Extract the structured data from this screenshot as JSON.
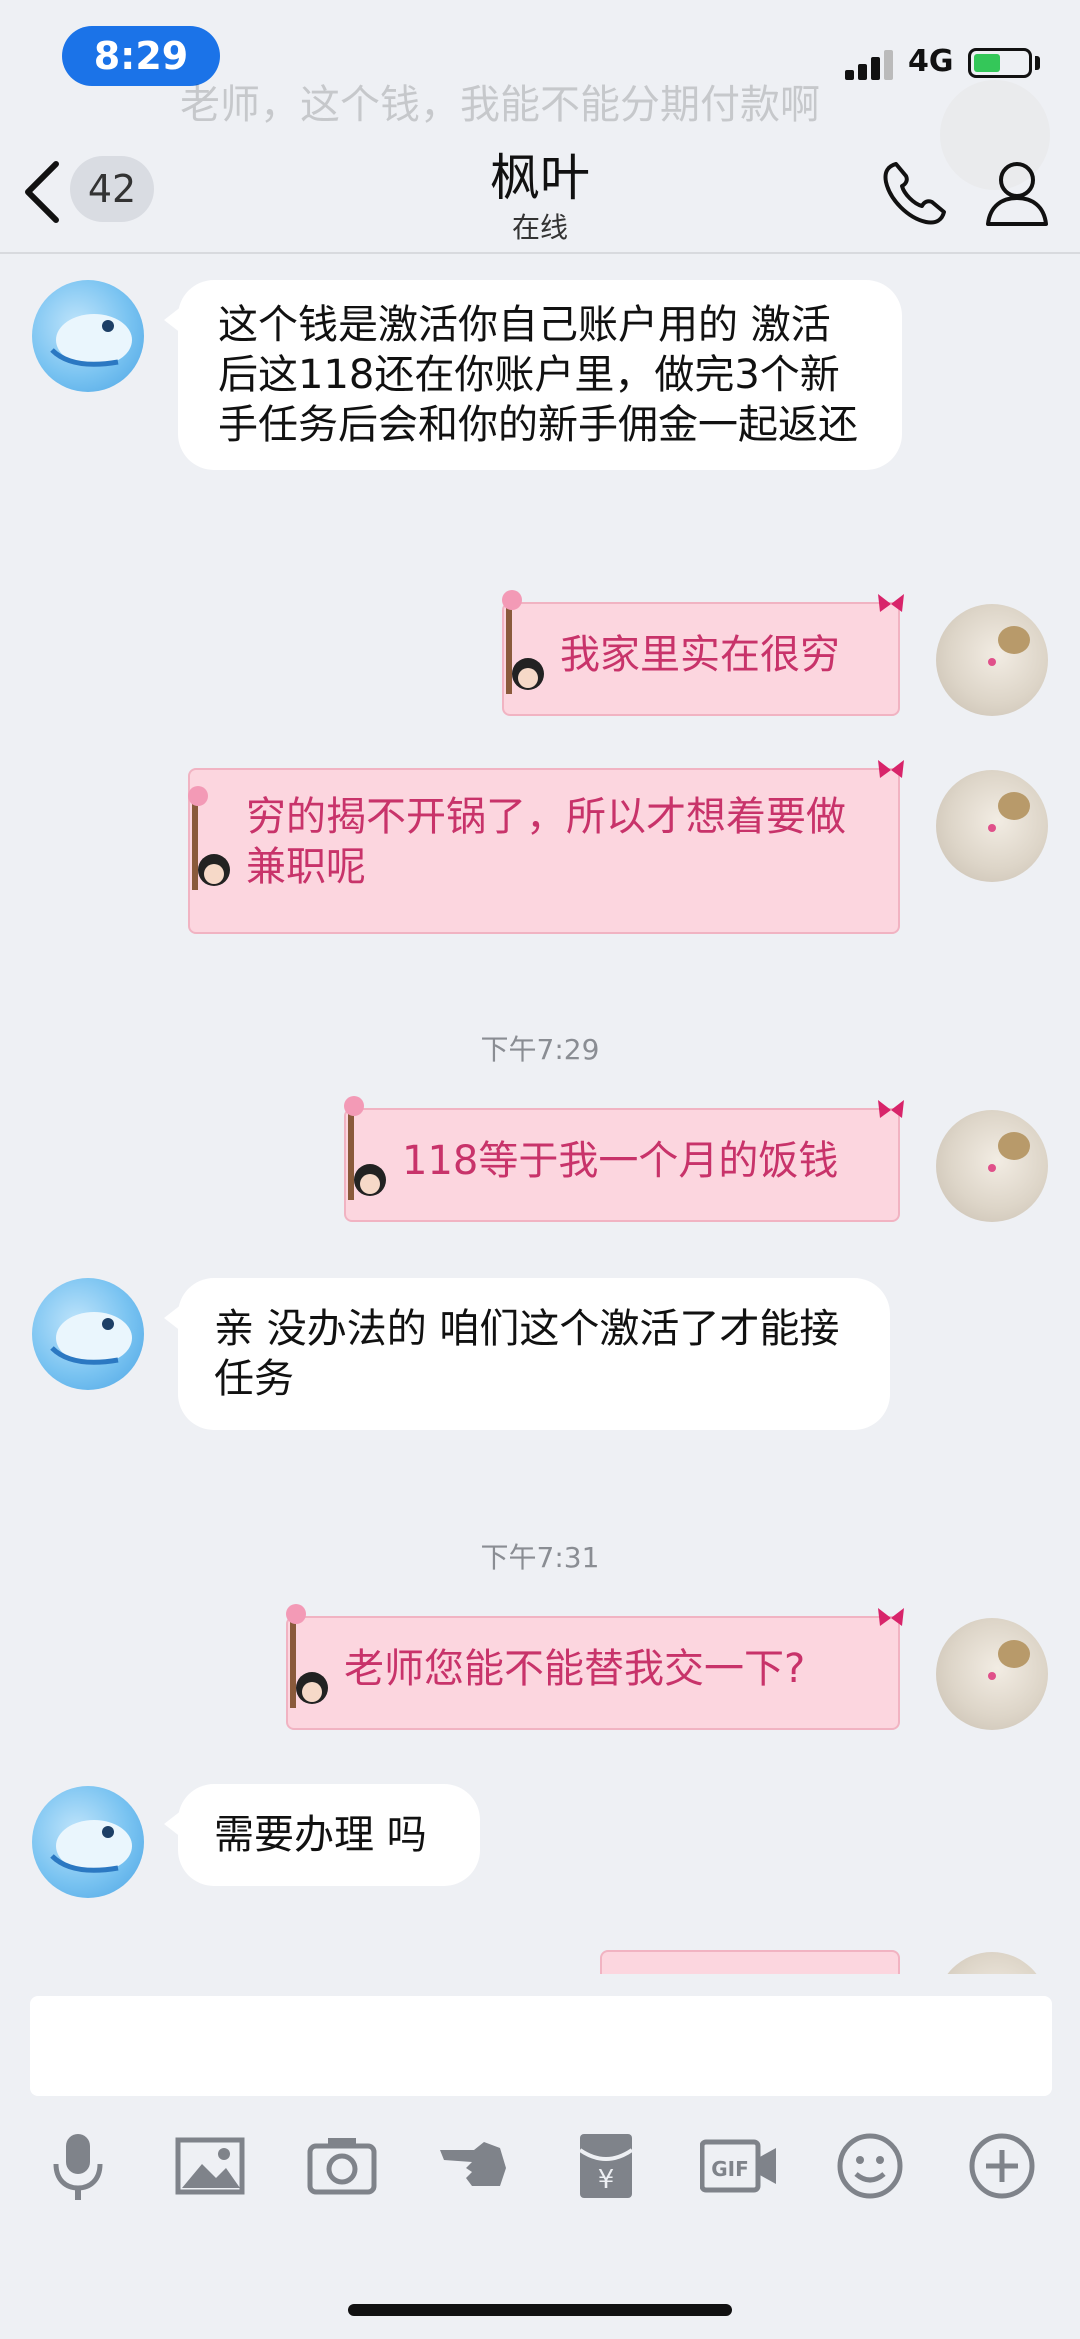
{
  "status_bar": {
    "time": "8:29",
    "network": "4G"
  },
  "header": {
    "back_count": "42",
    "title": "枫叶",
    "subtitle": "在线",
    "ghost_banner_text": "老师，这个钱，我能不能分期付款啊"
  },
  "messages": [
    {
      "side": "in",
      "text": "这个钱是激活你自己账户用的  激活后这118还在你账户里，做完3个新手任务后会和你的新手佣金一起返还"
    },
    {
      "side": "out",
      "text": "我家里实在很穷"
    },
    {
      "side": "out",
      "text": "穷的揭不开锅了，所以才想着要做兼职呢"
    },
    {
      "side": "time",
      "text": "下午7:29"
    },
    {
      "side": "out",
      "text": "118等于我一个月的饭钱"
    },
    {
      "side": "in",
      "text": "亲 没办法的 咱们这个激活了才能接任务"
    },
    {
      "side": "time",
      "text": "下午7:31"
    },
    {
      "side": "out",
      "text": "老师您能不能替我交一下?"
    },
    {
      "side": "in",
      "text": "需要办理 吗"
    }
  ],
  "toolbar": [
    "microphone-icon",
    "image-icon",
    "camera-icon",
    "poke-icon",
    "red-packet-icon",
    "gif-icon",
    "emoji-icon",
    "plus-icon"
  ],
  "colors": {
    "accent": "#1b73e8",
    "out_bubble": "#fcd6df",
    "out_text": "#c8336a"
  }
}
